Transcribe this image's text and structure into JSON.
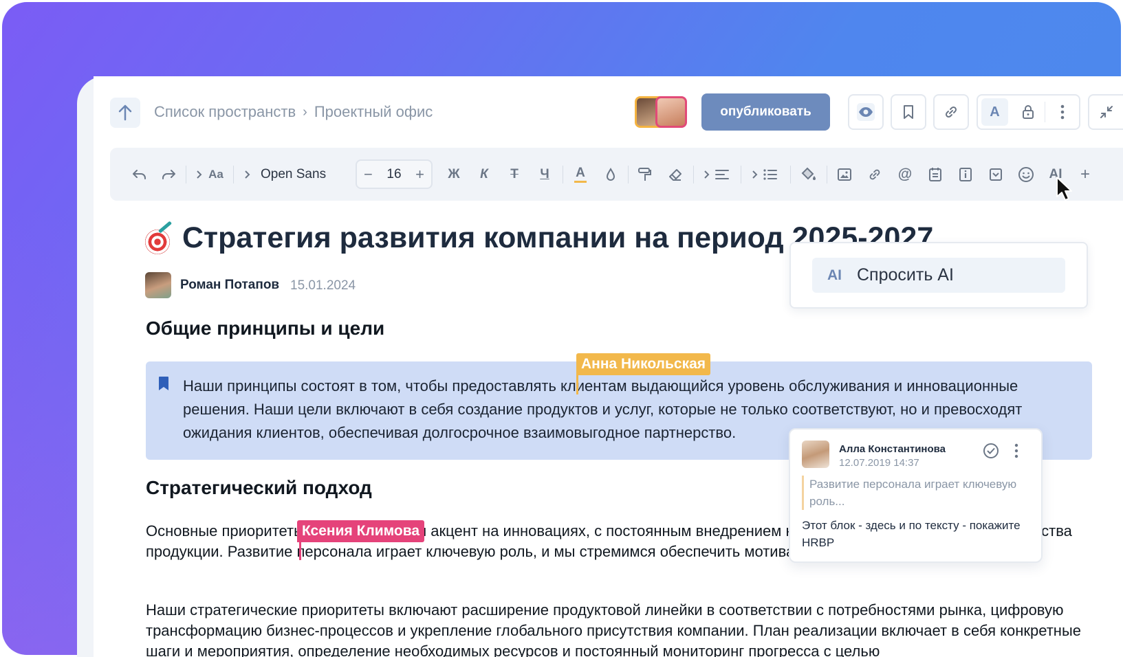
{
  "header": {
    "breadcrumb": [
      "Список пространств",
      "Проектный офис"
    ],
    "breadcrumb_sep": "›",
    "publish_label": "опубликовать"
  },
  "toolbar": {
    "font_family": "Open Sans",
    "font_size": "16",
    "minus": "−",
    "plus": "+",
    "bold": "Ж",
    "italic": "К",
    "strike": "Т",
    "underline": "Ч",
    "text_color": "A",
    "ai": "AI",
    "add": "+"
  },
  "document": {
    "title": "Стратегия развития компании на период 2025-2027",
    "author": "Роман Потапов",
    "date": "15.01.2024",
    "section1_heading": "Общие принципы и цели",
    "callout_text": "Наши принципы состоят в том, чтобы предоставлять клиентам выдающийся уровень обслуживания и инновационные решения. Наши цели включают в себя создание продуктов и услуг, которые не только соответствуют, но и превосходят ожидания клиентов, обеспечивая долгосрочное взаимовыгодное партнерство.",
    "section2_heading": "Стратегический подход",
    "para1": "Основные приоритеты включают в себя акцент на инновациях, с постоянным внедрением новых технологий и улучшения качества продукции. Развитие персонала играет ключевую роль, и мы стремимся обеспечить мотивацию сотрудников.",
    "para2": "Наши стратегические приоритеты включают расширение продуктовой линейки в соответствии с потребностями рынка, цифровую трансформацию бизнес-процессов и укрепление глобального присутствия компании. План реализации включает в себя конкретные шаги и мероприятия, определение необходимых ресурсов и постоянный мониторинг прогресса с целью"
  },
  "collaborators": {
    "anna": {
      "name": "Анна Никольская",
      "color": "#f2b84b"
    },
    "ksenia": {
      "name": "Ксения Климова",
      "color": "#e5437a"
    }
  },
  "ai_menu": {
    "icon_text": "AI",
    "item_label": "Спросить AI"
  },
  "comment": {
    "author": "Алла Константинова",
    "date": "12.07.2019 14:37",
    "quote": "Развитие персонала играет ключевую роль...",
    "text": "Этот блок - здесь и по тексту - покажите HRBP"
  },
  "colors": {
    "accent": "#6d8bbd",
    "callout_bg": "#cfdcf6",
    "title": "#1e2b3e"
  }
}
